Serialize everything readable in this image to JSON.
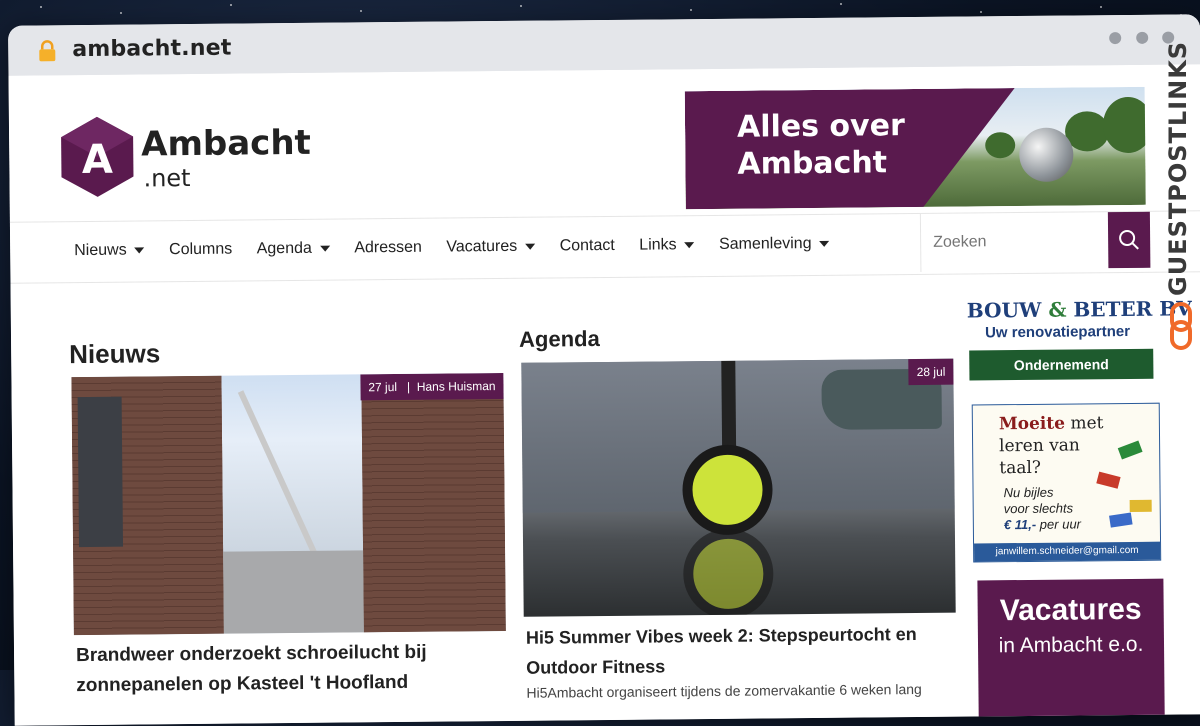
{
  "browser": {
    "url": "ambacht.net"
  },
  "logo": {
    "letter": "A",
    "name": "Ambacht",
    "tld": ".net"
  },
  "banner": {
    "line1": "Alles over",
    "line2": "Ambacht"
  },
  "nav": {
    "items": [
      {
        "label": "Nieuws",
        "dropdown": true
      },
      {
        "label": "Columns",
        "dropdown": false
      },
      {
        "label": "Agenda",
        "dropdown": true
      },
      {
        "label": "Adressen",
        "dropdown": false
      },
      {
        "label": "Vacatures",
        "dropdown": true
      },
      {
        "label": "Contact",
        "dropdown": false
      },
      {
        "label": "Links",
        "dropdown": true
      },
      {
        "label": "Samenleving",
        "dropdown": true
      }
    ],
    "search_placeholder": "Zoeken"
  },
  "news": {
    "title": "Nieuws",
    "date": "27 jul",
    "separator": "|",
    "author": "Hans Huisman",
    "headline": "Brandweer onderzoekt schroeilucht bij zonnepanelen op Kasteel 't Hoofland"
  },
  "agenda": {
    "title": "Agenda",
    "date": "28 jul",
    "headline": "Hi5 Summer Vibes week 2: Stepspeurtocht en Outdoor Fitness",
    "teaser": "Hi5Ambacht organiseert tijdens de zomervakantie 6 weken lang"
  },
  "sidebar": {
    "bouw_name_1": "BOUW",
    "bouw_amp": "&",
    "bouw_name_2": "BETER BV",
    "bouw_tagline": "Uw renovatiepartner",
    "ondernemend": "Ondernemend",
    "taal_word1": "Moeite",
    "taal_rest1": "met",
    "taal_line2": "leren van",
    "taal_line3": "taal?",
    "taal_offer1": "Nu bijles",
    "taal_offer2": "voor slechts",
    "taal_price": "€ 11,-",
    "taal_per": "per uur",
    "taal_email": "janwillem.schneider@gmail.com",
    "vac_line1": "Vacatures",
    "vac_line2": "in Ambacht e.o."
  },
  "watermark": {
    "text": "GUESTPOSTLINKS"
  },
  "colors": {
    "brand_purple": "#5a1a4e",
    "green": "#1e5b2e",
    "blue": "#1f3f7a"
  }
}
